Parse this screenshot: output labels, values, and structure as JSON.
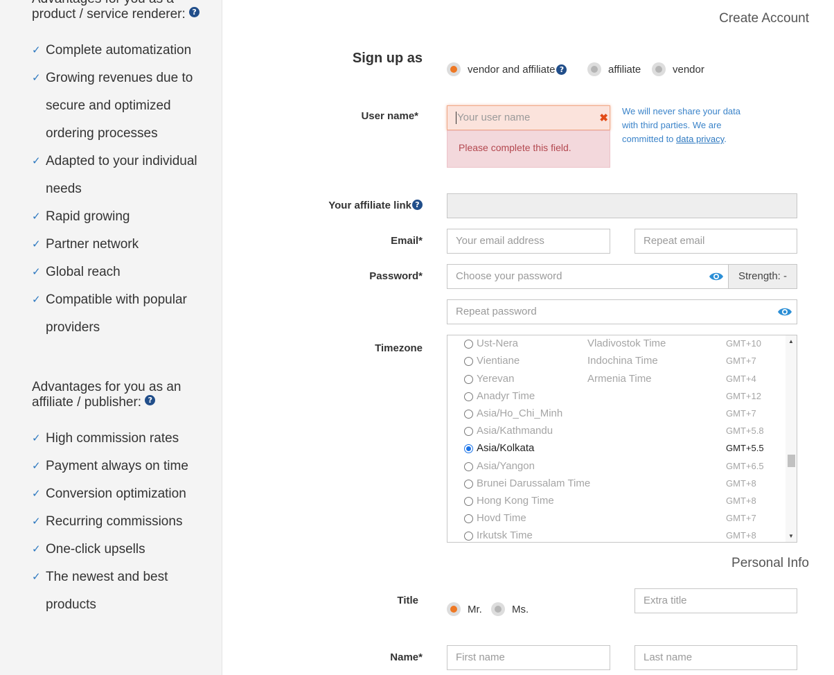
{
  "sidebar": {
    "renderer_title": "Advantages for you as a product / service renderer:",
    "renderer_items": [
      "Complete automatization",
      "Growing revenues due to secure and optimized ordering processes",
      "Adapted to your individual needs",
      "Rapid growing",
      "Partner network",
      "Global reach",
      "Compatible with popular providers"
    ],
    "affiliate_title": "Advantages for you as an affiliate / publisher:",
    "affiliate_items": [
      "High commission rates",
      "Payment always on time",
      "Conversion optimization",
      "Recurring commissions",
      "One-click upsells",
      "The newest and best products"
    ],
    "help_icon": "?",
    "check_icon": "✓"
  },
  "create_account": {
    "heading": "Create Account",
    "signup_label": "Sign up as",
    "signup_options": [
      "vendor and affiliate",
      "affiliate",
      "vendor"
    ],
    "signup_selected": "vendor and affiliate",
    "username_label": "User name*",
    "username_placeholder": "Your user name",
    "username_error": "Please complete this field.",
    "privacy_note_1": "We will never share your data with third parties. We are committed to",
    "privacy_link": "data privacy",
    "privacy_note_2": ".",
    "affiliate_link_label": "Your affiliate link",
    "email_label": "Email*",
    "email_placeholder": "Your email address",
    "email_repeat_placeholder": "Repeat email",
    "password_label": "Password*",
    "password_placeholder": "Choose your password",
    "password_strength": "Strength: -",
    "password_repeat_placeholder": "Repeat password",
    "timezone_label": "Timezone",
    "timezones": [
      {
        "name": "Ust-Nera",
        "long": "Vladivostok Time",
        "offset": "GMT+10",
        "selected": false
      },
      {
        "name": "Vientiane",
        "long": "Indochina Time",
        "offset": "GMT+7",
        "selected": false
      },
      {
        "name": "Yerevan",
        "long": "Armenia Time",
        "offset": "GMT+4",
        "selected": false
      },
      {
        "name": "Anadyr Time",
        "long": "",
        "offset": "GMT+12",
        "selected": false
      },
      {
        "name": "Asia/Ho_Chi_Minh",
        "long": "",
        "offset": "GMT+7",
        "selected": false
      },
      {
        "name": "Asia/Kathmandu",
        "long": "",
        "offset": "GMT+5.8",
        "selected": false
      },
      {
        "name": "Asia/Kolkata",
        "long": "",
        "offset": "GMT+5.5",
        "selected": true
      },
      {
        "name": "Asia/Yangon",
        "long": "",
        "offset": "GMT+6.5",
        "selected": false
      },
      {
        "name": "Brunei Darussalam Time",
        "long": "",
        "offset": "GMT+8",
        "selected": false
      },
      {
        "name": "Hong Kong Time",
        "long": "",
        "offset": "GMT+8",
        "selected": false
      },
      {
        "name": "Hovd Time",
        "long": "",
        "offset": "GMT+7",
        "selected": false
      },
      {
        "name": "Irkutsk Time",
        "long": "",
        "offset": "GMT+8",
        "selected": false
      }
    ]
  },
  "personal_info": {
    "heading": "Personal Info",
    "title_label": "Title",
    "title_options": [
      "Mr.",
      "Ms."
    ],
    "title_selected": "Mr.",
    "extra_title_placeholder": "Extra title",
    "name_label": "Name*",
    "first_name_placeholder": "First name",
    "last_name_placeholder": "Last name"
  },
  "colors": {
    "accent_orange": "#ee7824",
    "link_blue": "#2c78c0",
    "help_icon_blue": "#214e8a",
    "error_bg": "#f3d8dc",
    "error_text": "#b3474f"
  }
}
